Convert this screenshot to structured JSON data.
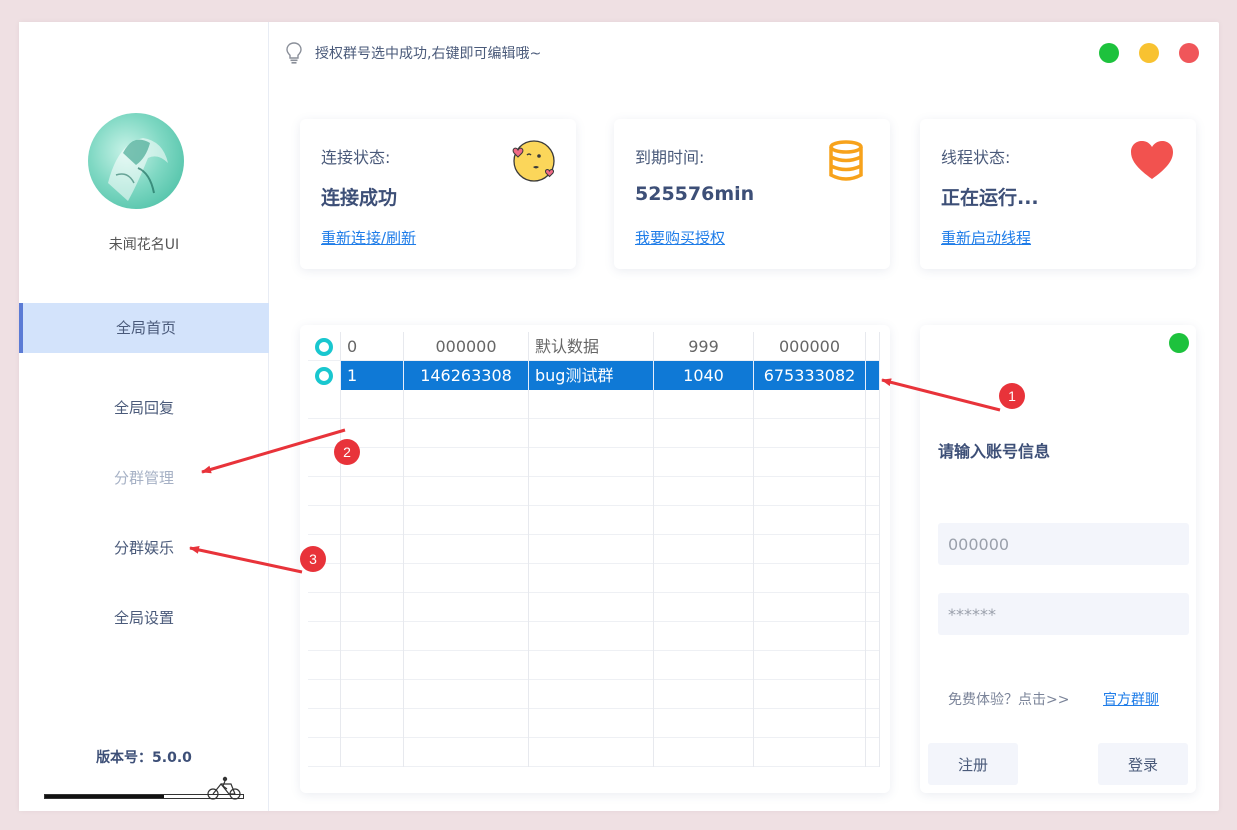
{
  "sidebar": {
    "username": "未闻花名UI",
    "nav": [
      {
        "label": "全局首页",
        "state": "active"
      },
      {
        "label": "全局回复",
        "state": "normal"
      },
      {
        "label": "分群管理",
        "state": "muted"
      },
      {
        "label": "分群娱乐",
        "state": "normal"
      },
      {
        "label": "全局设置",
        "state": "normal"
      }
    ],
    "version": "版本号：5.0.0",
    "progress_fraction": 0.6
  },
  "header": {
    "tip": "授权群号选中成功,右键即可编辑哦~",
    "window_buttons": [
      {
        "name": "minimize-button",
        "color": "#1dc23d"
      },
      {
        "name": "maximize-button",
        "color": "#f8c231"
      },
      {
        "name": "close-button",
        "color": "#f0565a"
      }
    ]
  },
  "cards": [
    {
      "label": "连接状态:",
      "value": "连接成功",
      "link": "重新连接/刷新",
      "icon": "smiley-icon"
    },
    {
      "label": "到期时间:",
      "value": "525576min",
      "link": "我要购买授权",
      "icon": "database-icon"
    },
    {
      "label": "线程状态:",
      "value": "正在运行...",
      "link": "重新启动线程",
      "icon": "heart-icon"
    }
  ],
  "grid": {
    "rows": [
      {
        "cells": [
          "0",
          "000000",
          "默认数据",
          "999",
          "000000"
        ],
        "selected": false
      },
      {
        "cells": [
          "1",
          "146263308",
          "bug测试群",
          "1040",
          "675333082"
        ],
        "selected": true
      }
    ],
    "empty_rows": 13
  },
  "login": {
    "title": "请输入账号信息",
    "account_placeholder": "000000",
    "password_placeholder": "******",
    "trial_text": "免费体验？点击>>",
    "group_link": "官方群聊",
    "register_label": "注册",
    "login_label": "登录",
    "status_color": "#1dc23d"
  },
  "annotations": [
    "1",
    "2",
    "3"
  ],
  "colors": {
    "accent": "#1e7ce8",
    "selection": "#0f79d6",
    "nav_active": "#d3e3fb",
    "annotation": "#e8333a"
  }
}
